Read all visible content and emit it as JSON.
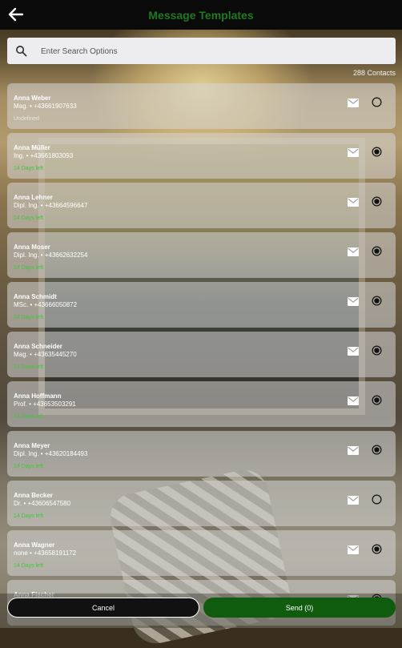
{
  "header": {
    "title": "Message Templates",
    "back_icon": "arrow-left-icon"
  },
  "search": {
    "placeholder": "Enter Search Options",
    "value": "",
    "icon": "search-icon"
  },
  "contacts_count": "288 Contacts",
  "colors": {
    "accent_green": "#1f7a1f",
    "status_green": "#3cc83c",
    "send_bg": "#0f5c0f"
  },
  "contacts": [
    {
      "name": "Anna Weber",
      "sub": "Mag. • +43661907633",
      "status": "Undefined",
      "status_color": "#e8e8e8",
      "selected": false
    },
    {
      "name": "Anna Müller",
      "sub": "Ing. • +43661803093",
      "status": "14 Days left",
      "status_color": "#3cc83c",
      "selected": true
    },
    {
      "name": "Anna Lehner",
      "sub": "Dipl. Ing. • +43664596647",
      "status": "14 Days left",
      "status_color": "#3cc83c",
      "selected": true
    },
    {
      "name": "Anna Moser",
      "sub": "Dipl. Ing. • +43662632254",
      "status": "14 Days left",
      "status_color": "#3cc83c",
      "selected": true
    },
    {
      "name": "Anna Schmidt",
      "sub": "MSc. • +43666050872",
      "status": "14 Days left",
      "status_color": "#3cc83c",
      "selected": true
    },
    {
      "name": "Anna Schneider",
      "sub": "Mag. • +43635445270",
      "status": "14 Days left",
      "status_color": "#3cc83c",
      "selected": true
    },
    {
      "name": "Anna Hoffmann",
      "sub": "Prof. • +43653503291",
      "status": "14 Days left",
      "status_color": "#3cc83c",
      "selected": true
    },
    {
      "name": "Anna Meyer",
      "sub": "Dipl. Ing. • +43620184493",
      "status": "14 Days left",
      "status_color": "#3cc83c",
      "selected": true
    },
    {
      "name": "Anna Becker",
      "sub": "Dr. • +43606547580",
      "status": "14 Days left",
      "status_color": "#3cc83c",
      "selected": false
    },
    {
      "name": "Anna Wagner",
      "sub": "none • +43658191172",
      "status": "14 Days left",
      "status_color": "#3cc83c",
      "selected": true
    },
    {
      "name": "Anna Fischer",
      "sub": "",
      "status": "",
      "status_color": "#3cc83c",
      "selected": true
    }
  ],
  "actions": {
    "cancel_label": "Cancel",
    "send_label": "Send (0)"
  }
}
